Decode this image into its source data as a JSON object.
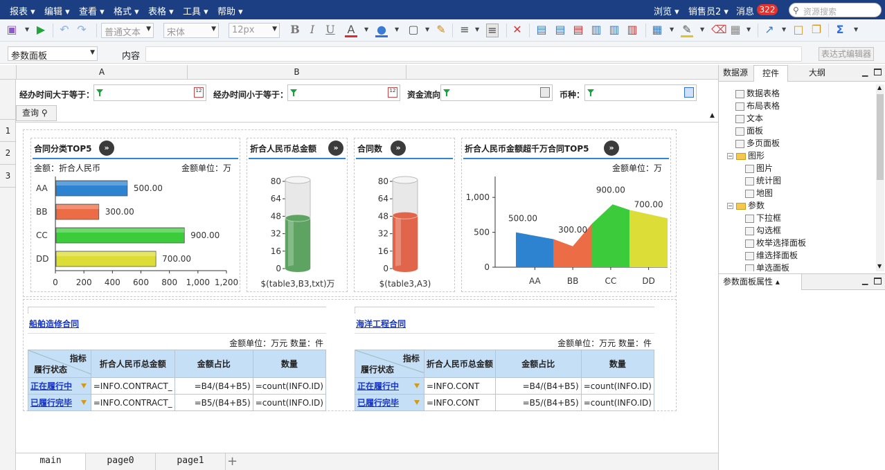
{
  "menu": {
    "items": [
      "报表",
      "编辑",
      "查看",
      "格式",
      "表格",
      "工具",
      "帮助"
    ],
    "browse": "浏览",
    "user": "销售员2",
    "messages_label": "消息",
    "messages_count": "322",
    "search_placeholder": "资源搜索"
  },
  "toolbar": {
    "style_value": "普通文本",
    "font_value": "宋体",
    "size_value": "12px",
    "bold": "B",
    "italic": "I",
    "underline": "U",
    "font_color": "A",
    "sum": "Σ"
  },
  "formula": {
    "select_value": "参数面板",
    "content_label": "内容",
    "content_value": "",
    "editor_button": "表达式编辑器"
  },
  "sheet": {
    "columns": [
      "A",
      "B"
    ],
    "rows": [
      "1",
      "2",
      "3"
    ]
  },
  "params": {
    "from_label": "经办时间大于等于：",
    "to_label": "经办时间小于等于：",
    "flow_label": "资金流向",
    "currency_label": "币种：",
    "query_button": "查询"
  },
  "charts": [
    {
      "title": "合同分类TOP5",
      "left_note": "金额：折合人民币",
      "right_note": "金额单位：万",
      "chart_data": {
        "type": "bar",
        "categories": [
          "AA",
          "BB",
          "CC",
          "DD"
        ],
        "values": [
          500,
          300,
          900,
          700
        ],
        "value_labels": [
          "500.00",
          "300.00",
          "900.00",
          "700.00"
        ],
        "xlim": [
          0,
          1200
        ],
        "xticks": [
          "0",
          "200",
          "400",
          "600",
          "800",
          "1,000",
          "1,200"
        ],
        "colors": [
          "#2d83cf",
          "#ec6c45",
          "#3ccb3b",
          "#dcdd36"
        ]
      }
    },
    {
      "title": "折合人民币总金额",
      "chart_data": {
        "type": "bar",
        "gauge": "cylinder",
        "yticks": [
          "80",
          "64",
          "48",
          "32",
          "16",
          "0"
        ],
        "ylim": [
          0,
          80
        ],
        "fill": 0.57,
        "color": "#5fa362",
        "xlabel": "$(table3,B3,txt)万"
      }
    },
    {
      "title": "合同数",
      "chart_data": {
        "type": "bar",
        "gauge": "cylinder",
        "yticks": [
          "80",
          "64",
          "48",
          "32",
          "16",
          "0"
        ],
        "ylim": [
          0,
          80
        ],
        "fill": 0.6,
        "color": "#e0654a",
        "xlabel": "$(table3,A3)"
      }
    },
    {
      "title": "折合人民币金额超千万合同TOP5",
      "right_note": "金额单位：万",
      "chart_data": {
        "type": "area",
        "categories": [
          "AA",
          "BB",
          "CC",
          "DD"
        ],
        "values": [
          500,
          300,
          900,
          700
        ],
        "value_labels": [
          "500.00",
          "300.00",
          "900.00",
          "700.00"
        ],
        "ylim": [
          0,
          1200
        ],
        "yticks": [
          "0",
          "500",
          "1,000"
        ],
        "colors": [
          "#2d83cf",
          "#ec6c45",
          "#3ccb3b",
          "#dcdd36"
        ]
      }
    }
  ],
  "tables": [
    {
      "link": "船舶造修合同",
      "unit_note": "金额单位：万元  数量：件",
      "corner_top": "指标",
      "corner_bottom": "履行状态",
      "headers": [
        "折合人民币总金额",
        "金额占比",
        "数量"
      ],
      "rows": [
        {
          "status": "正在履行中",
          "amount": "=INFO.CONTRACT_",
          "ratio": "=B4/(B4+B5)",
          "count": "=count(INFO.ID)"
        },
        {
          "status": "已履行完毕",
          "amount": "=INFO.CONTRACT_",
          "ratio": "=B5/(B4+B5)",
          "count": "=count(INFO.ID)"
        }
      ]
    },
    {
      "link": "海洋工程合同",
      "unit_note": "金额单位：万元  数量：件",
      "corner_top": "指标",
      "corner_bottom": "履行状态",
      "headers": [
        "折合人民币总金额",
        "金额占比",
        "数量"
      ],
      "rows": [
        {
          "status": "正在履行中",
          "amount": "=INFO.CONT",
          "ratio": "=B4/(B4+B5)",
          "count": "=count(INFO.ID)"
        },
        {
          "status": "已履行完毕",
          "amount": "=INFO.CONT",
          "ratio": "=B5/(B4+B5)",
          "count": "=count(INFO.ID)"
        }
      ]
    }
  ],
  "sheet_tabs": [
    "main",
    "page0",
    "page1"
  ],
  "add_tab": "+",
  "right_panel": {
    "tabs": [
      "数据源",
      "控件",
      "大纲"
    ],
    "tree": [
      {
        "label": "数据表格",
        "level": 1,
        "icon": "table-icon"
      },
      {
        "label": "布局表格",
        "level": 1,
        "icon": "layout-table-icon"
      },
      {
        "label": "文本",
        "level": 1,
        "icon": "text-icon"
      },
      {
        "label": "面板",
        "level": 1,
        "icon": "panel-icon"
      },
      {
        "label": "多页面板",
        "level": 1,
        "icon": "multipage-panel-icon"
      },
      {
        "label": "图形",
        "level": 0,
        "icon": "folder-icon"
      },
      {
        "label": "图片",
        "level": 1,
        "icon": "image-icon"
      },
      {
        "label": "统计图",
        "level": 1,
        "icon": "chart-icon"
      },
      {
        "label": "地图",
        "level": 1,
        "icon": "map-icon"
      },
      {
        "label": "参数",
        "level": 0,
        "icon": "folder-icon"
      },
      {
        "label": "下拉框",
        "level": 1,
        "icon": "dropdown-icon"
      },
      {
        "label": "勾选框",
        "level": 1,
        "icon": "checkbox-icon"
      },
      {
        "label": "枚举选择面板",
        "level": 1,
        "icon": "enum-panel-icon"
      },
      {
        "label": "维选择面板",
        "level": 1,
        "icon": "dimension-panel-icon"
      },
      {
        "label": "单选面板",
        "level": 1,
        "icon": "radio-panel-icon"
      }
    ],
    "props_title": "参数面板属性"
  }
}
